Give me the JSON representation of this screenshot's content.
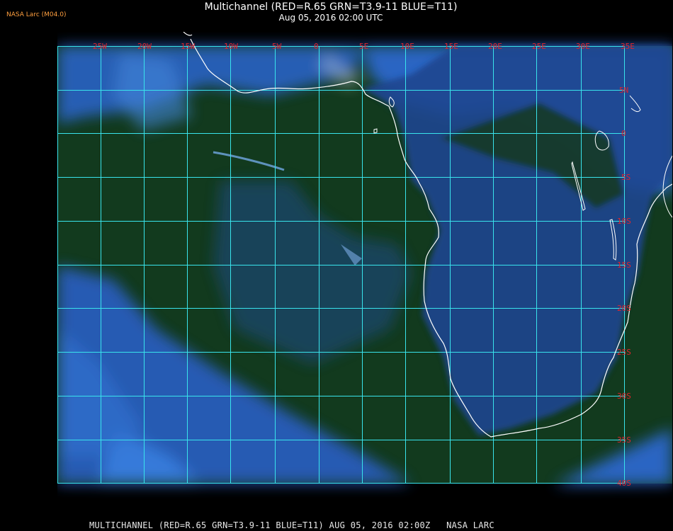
{
  "logo": "NASA Larc (M04.0)",
  "title": "Multichannel (RED=R.65 GRN=T3.9-11 BLUE=T11)",
  "subtitle": "Aug 05, 2016 02:00 UTC",
  "footer": "MULTICHANNEL (RED=R.65 GRN=T3.9-11 BLUE=T11) AUG 05, 2016 02:00Z   NASA LARC",
  "colors": {
    "grid": "#39e4ec",
    "labels": "#e0242c",
    "coastline": "#ffffff",
    "ocean": "#123a1e",
    "cloud": "#2f6ed8",
    "land": "#1f3f8a"
  },
  "map": {
    "longitude_labels": [
      "25W",
      "20W",
      "15W",
      "10W",
      "5W",
      "0",
      "5E",
      "10E",
      "15E",
      "20E",
      "25E",
      "30E",
      "35E"
    ],
    "latitude_labels": [
      "5N",
      "0",
      "5S",
      "10S",
      "15S",
      "20S",
      "25S",
      "30S",
      "35S",
      "40S"
    ],
    "region": "Atlantic Ocean and southern Africa"
  }
}
